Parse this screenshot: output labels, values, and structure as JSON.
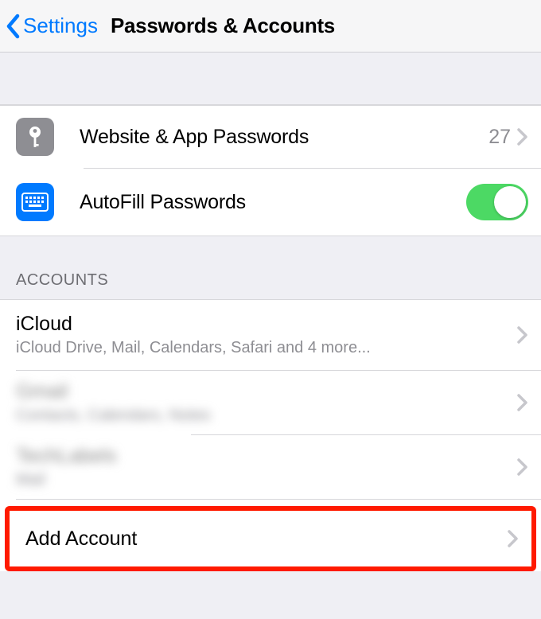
{
  "nav": {
    "back_label": "Settings",
    "title": "Passwords & Accounts"
  },
  "group1": {
    "row1": {
      "label": "Website & App Passwords",
      "count": "27"
    },
    "row2": {
      "label": "AutoFill Passwords"
    }
  },
  "section_header": "ACCOUNTS",
  "accounts": {
    "icloud": {
      "title": "iCloud",
      "sub": "iCloud Drive, Mail, Calendars, Safari and 4 more..."
    },
    "acct2": {
      "title": "Gmail",
      "sub": "Contacts, Calendars, Notes"
    },
    "acct3": {
      "title": "TechLabels",
      "sub": "Mail"
    }
  },
  "add_account": "Add Account"
}
